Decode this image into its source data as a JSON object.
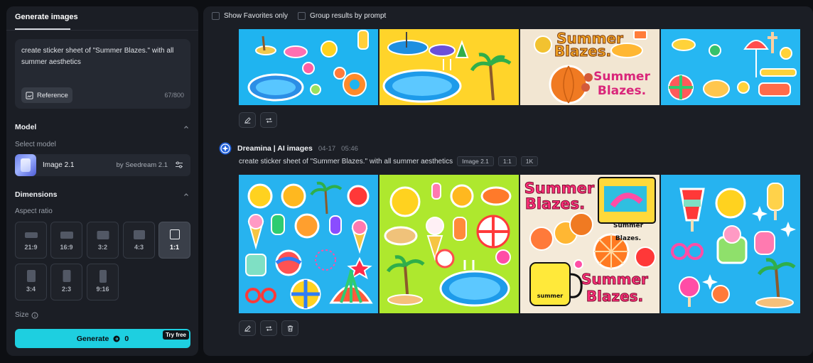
{
  "left_panel": {
    "tab_label": "Generate images",
    "prompt_text": "create sticker sheet of \"Summer Blazes.\" with all summer aesthetics",
    "reference_label": "Reference",
    "char_counter": "67/800",
    "model_section": {
      "title": "Model",
      "select_label": "Select model",
      "model_name": "Image 2.1",
      "model_by": "by Seedream 2.1"
    },
    "dimensions_section": {
      "title": "Dimensions",
      "aspect_label": "Aspect ratio",
      "ratios": [
        "21:9",
        "16:9",
        "3:2",
        "4:3",
        "1:1",
        "3:4",
        "2:3",
        "9:16"
      ],
      "selected_ratio": "1:1",
      "size_label": "Size"
    },
    "generate": {
      "label": "Generate",
      "credits": "0",
      "badge": "Try free"
    }
  },
  "right_panel": {
    "options": {
      "favorites_label": "Show Favorites only",
      "group_label": "Group results by prompt"
    },
    "result": {
      "bot_name": "Dreamina | AI images",
      "date": "04-17",
      "time": "05:46",
      "prompt": "create sticker sheet of \"Summer Blazes.\" with all summer aesthetics",
      "tags": [
        "Image 2.1",
        "1:1",
        "1K"
      ]
    },
    "image_labels": {
      "top_tile3_line1": "Summer",
      "top_tile3_line2": "Blazes.",
      "top_tile3_line3": "Summer",
      "top_tile3_line4": "Blazes.",
      "bot_tile3_line1": "Summer",
      "bot_tile3_line2": "Blazes.",
      "bot_tile3_small": "Summer Blazes.",
      "bot_tile3_mug": "summer",
      "bot_tile3_line3": "Summer",
      "bot_tile3_line4": "Blazes."
    }
  },
  "colors": {
    "accent": "#1ecfe0",
    "panel_bg": "#1b1e25",
    "page_bg": "#0d0f13"
  }
}
